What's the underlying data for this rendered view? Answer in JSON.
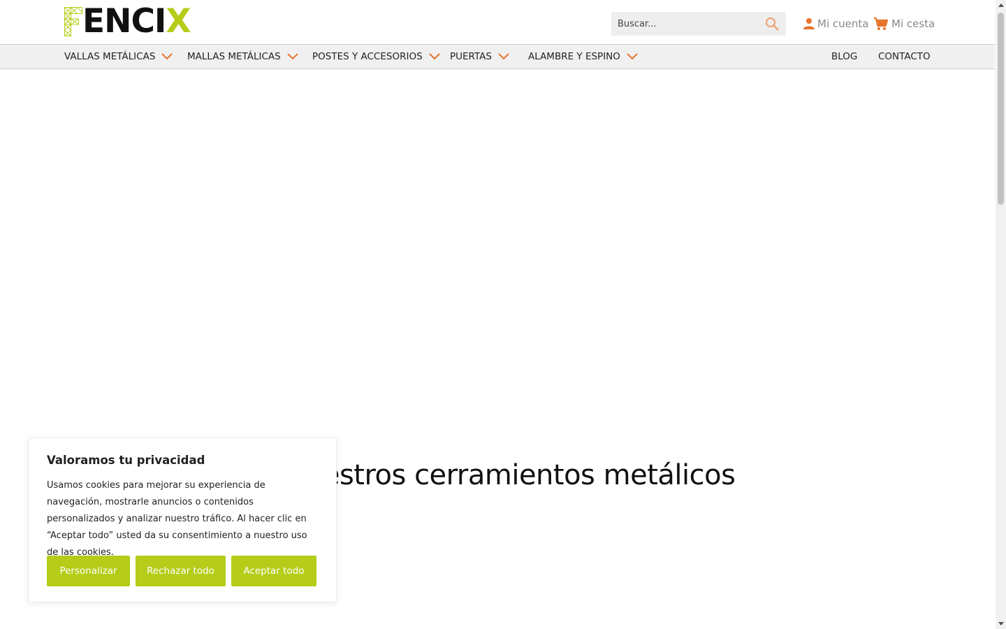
{
  "header": {
    "logo": {
      "text_main": "ENCI",
      "text_accent": "X",
      "f_letter": "F",
      "accent_color": "#b5cc18"
    },
    "search": {
      "placeholder": "Buscar...",
      "icon": "search-icon"
    },
    "account": {
      "label": "Mi cuenta",
      "icon": "person-icon"
    },
    "cart": {
      "label": "Mi cesta",
      "icon": "cart-icon"
    }
  },
  "nav": {
    "items": [
      {
        "label": "VALLAS METÁLICAS",
        "has_dropdown": true
      },
      {
        "label": "MALLAS METÁLICAS",
        "has_dropdown": true
      },
      {
        "label": "POSTES Y ACCESORIOS",
        "has_dropdown": true
      },
      {
        "label": "PUERTAS",
        "has_dropdown": true
      },
      {
        "label": "ALAMBRE Y ESPINO",
        "has_dropdown": true
      }
    ],
    "right_items": [
      {
        "label": "BLOG"
      },
      {
        "label": "CONTACTO"
      }
    ],
    "chevron_color": "#e8732a"
  },
  "hero": {
    "heading": "Nuestros cerramientos metálicos"
  },
  "cookie_banner": {
    "title": "Valoramos tu privacidad",
    "text": "Usamos cookies para mejorar su experiencia de navegación, mostrarle anuncios o contenidos personalizados y analizar nuestro tráfico. Al hacer clic en “Aceptar todo” usted da su consentimiento a nuestro uso de las cookies.",
    "buttons": {
      "customize": "Personalizar",
      "reject": "Rechazar todo",
      "accept": "Aceptar todo"
    },
    "button_color": "#b5cc18"
  },
  "colors": {
    "accent_orange": "#e8732a",
    "brand_green": "#b5cc18"
  }
}
